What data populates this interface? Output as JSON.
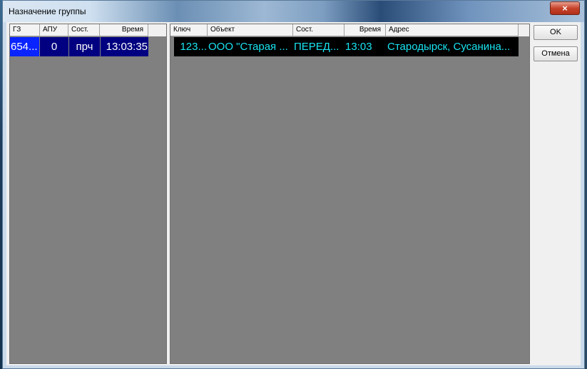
{
  "window": {
    "title": "Назначение группы",
    "close_glyph": "×"
  },
  "left_table": {
    "columns": [
      "ГЗ",
      "АПУ",
      "Сост.",
      "Время"
    ],
    "rows": [
      {
        "gz": "654...",
        "apu": "0",
        "state": "прч",
        "time": "13:03:35"
      }
    ]
  },
  "right_table": {
    "columns": [
      "Ключ",
      "Объект",
      "Сост.",
      "Время",
      "Адрес"
    ],
    "rows": [
      {
        "key": "123...",
        "object": "ООО \"Старая ...",
        "state": "ПЕРЕД...",
        "time": "13:03",
        "address": "Стародырск, Сусанина..."
      }
    ]
  },
  "buttons": {
    "ok": "OK",
    "cancel": "Отмена"
  },
  "colors": {
    "selected_row_bg": "#000080",
    "selected_cell_bg": "#0a24ff",
    "object_row_bg": "#000000",
    "object_row_text": "#19e3f0",
    "panel_bg": "#808080"
  }
}
